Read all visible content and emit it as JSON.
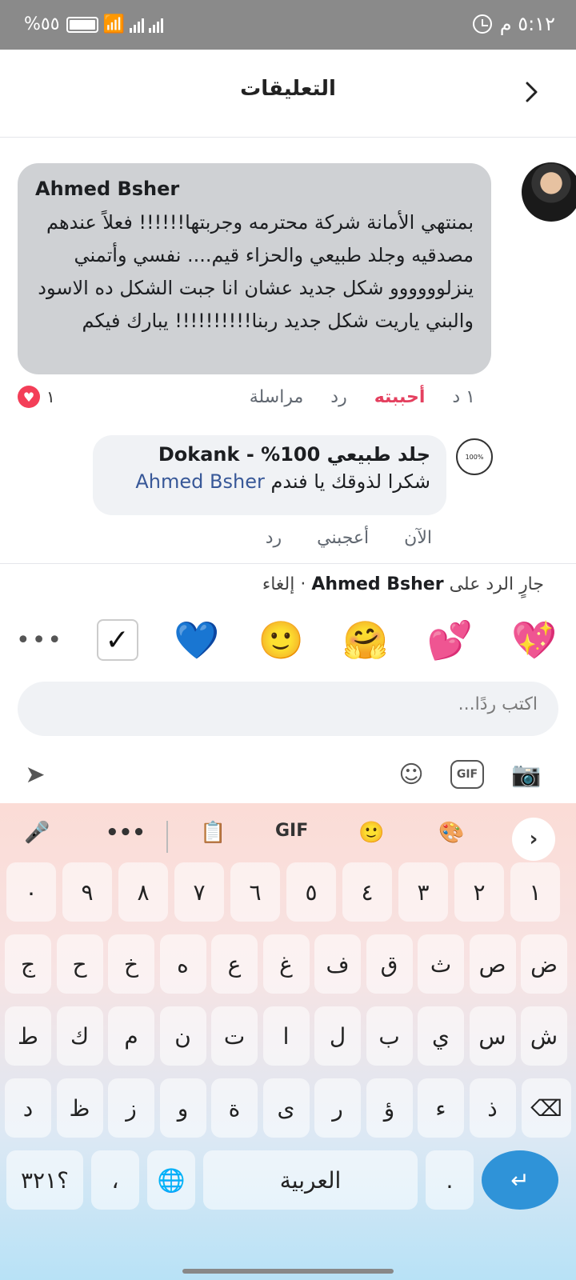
{
  "status": {
    "battery": "%٥٥",
    "time": "٥:١٢ م"
  },
  "header": {
    "title": "التعليقات"
  },
  "comment": {
    "author": "Ahmed Bsher",
    "text": "بمنتهي الأمانة شركة محترمه وجربتها!!!!!! فعلاً عندهم مصدقيه وجلد طبيعي والحزاء قيم.... نفسي وأتمني ينزلوووووو شكل جديد عشان انا جبت الشكل ده الاسود والبني ياريت شكل جديد ربنا!!!!!!!!!! يبارك فيكم",
    "time": "١ د",
    "liked": "أحببته",
    "reply": "رد",
    "message": "مراسلة",
    "reaction_count": "١"
  },
  "reply_comment": {
    "author": "جلد طبيعي 100% - Dokank",
    "text": "شكرا لذوقك يا فندم",
    "mention": "Ahmed Bsher",
    "time": "الآن",
    "like": "أعجبني",
    "reply": "رد",
    "avatar_text": "100%"
  },
  "replying": {
    "prefix": "جارٍ الرد على",
    "name": "Ahmed Bsher",
    "cancel": "· إلغاء"
  },
  "emojis": [
    "💖",
    "💕",
    "🤗",
    "🙂",
    "💙"
  ],
  "input": {
    "placeholder": "اكتب ردًا..."
  },
  "keyboard": {
    "gif": "GIF",
    "row1": [
      "١",
      "٢",
      "٣",
      "٤",
      "٥",
      "٦",
      "٧",
      "٨",
      "٩",
      "٠"
    ],
    "row2": [
      "ض",
      "ص",
      "ث",
      "ق",
      "ف",
      "غ",
      "ع",
      "ه",
      "خ",
      "ح",
      "ج"
    ],
    "row3": [
      "ش",
      "س",
      "ي",
      "ب",
      "ل",
      "ا",
      "ت",
      "ن",
      "م",
      "ك",
      "ط"
    ],
    "row4": [
      "ذ",
      "ء",
      "ؤ",
      "ر",
      "ى",
      "ة",
      "و",
      "ز",
      "ظ",
      "د"
    ],
    "space": "العربية",
    "sym": "؟٣٢١",
    "comma": "،",
    "period": "."
  }
}
